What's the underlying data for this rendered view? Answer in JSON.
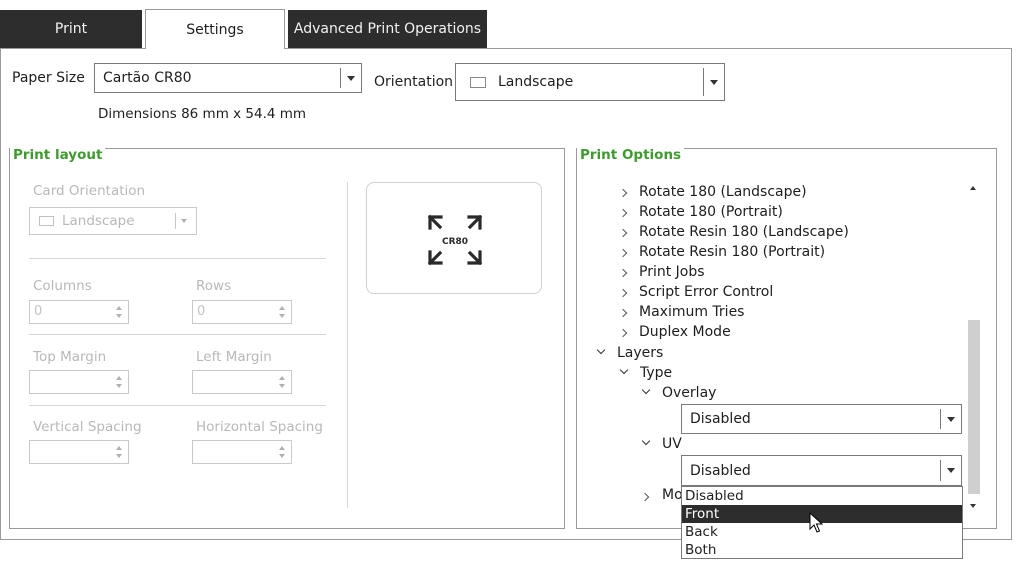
{
  "tabs": [
    {
      "label": "Print"
    },
    {
      "label": "Settings"
    },
    {
      "label": "Advanced Print Operations"
    }
  ],
  "paper": {
    "label": "Paper Size",
    "value": "Cartão CR80",
    "dimensions": "Dimensions 86 mm x 54.4 mm"
  },
  "orientation": {
    "label": "Orientation",
    "value": "Landscape"
  },
  "print_layout": {
    "title": "Print layout",
    "card_orientation_label": "Card Orientation",
    "card_orientation_value": "Landscape",
    "columns_label": "Columns",
    "columns_value": "0",
    "rows_label": "Rows",
    "rows_value": "0",
    "top_margin_label": "Top Margin",
    "left_margin_label": "Left Margin",
    "vertical_spacing_label": "Vertical Spacing",
    "horizontal_spacing_label": "Horizontal Spacing",
    "preview_text": "CR80"
  },
  "print_options": {
    "title": "Print Options",
    "items": [
      "Rotate 180 (Landscape)",
      "Rotate 180 (Portrait)",
      "Rotate Resin 180 (Landscape)",
      "Rotate Resin 180 (Portrait)",
      "Print Jobs",
      "Script Error Control",
      "Maximum Tries",
      "Duplex Mode"
    ],
    "layers_label": "Layers",
    "type_label": "Type",
    "overlay_label": "Overlay",
    "overlay_value": "Disabled",
    "uv_label": "UV",
    "uv_value": "Disabled",
    "more_label_partial": "Mo",
    "uv_options": [
      "Disabled",
      "Front",
      "Back",
      "Both"
    ],
    "uv_highlighted": "Front"
  },
  "colors": {
    "accent_green": "#3f9b2e",
    "dark_tab": "#2d2d2d"
  }
}
